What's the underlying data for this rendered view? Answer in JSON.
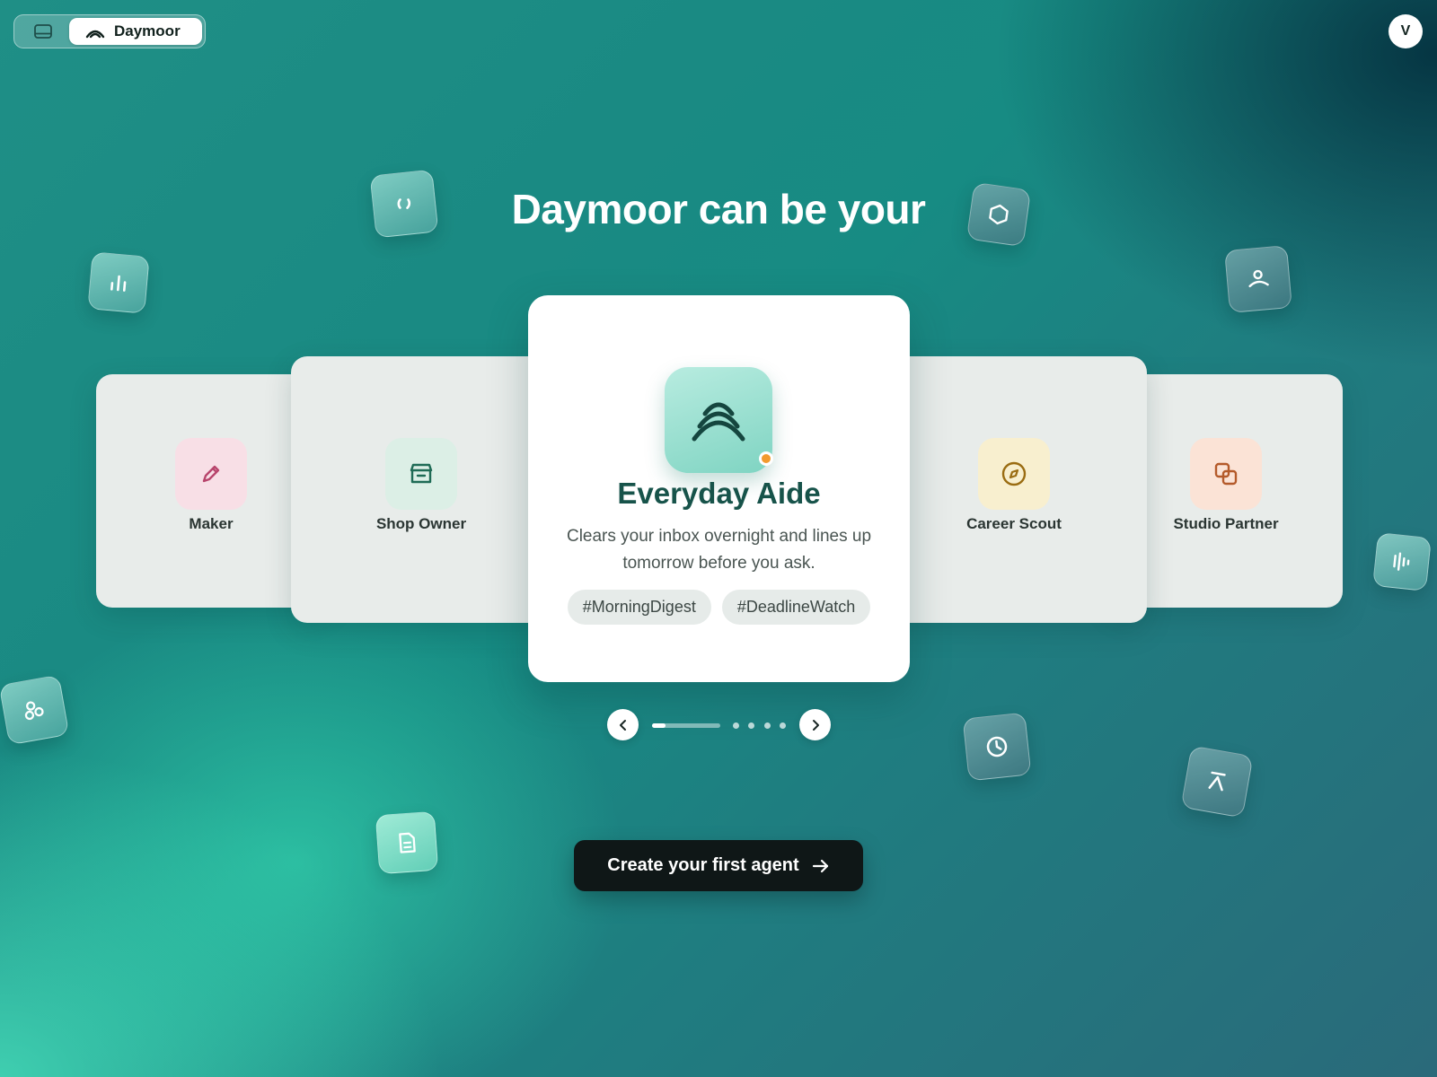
{
  "topbar": {
    "layout_icon": "panel-layout-icon",
    "brand_icon": "daymoor-logo-icon",
    "brand_name": "Daymoor",
    "avatar_initial": "V"
  },
  "headline": "Daymoor can be your",
  "carousel": {
    "cards": [
      {
        "label": "Maker",
        "icon": "pencil-icon",
        "icon_bg": "#f8dfe6",
        "icon_color": "#b8456c"
      },
      {
        "label": "Shop Owner",
        "icon": "storefront-icon",
        "icon_bg": "#dcefe6",
        "icon_color": "#1e6b55"
      },
      {
        "label": "Career Scout",
        "icon": "compass-icon",
        "icon_bg": "#f8efcf",
        "icon_color": "#9a6c12"
      },
      {
        "label": "Studio Partner",
        "icon": "overlap-squares-icon",
        "icon_bg": "#fbe3d6",
        "icon_color": "#b45a2a"
      }
    ],
    "featured": {
      "title": "Everyday Aide",
      "description": "Clears your inbox overnight and lines up tomorrow before you ask.",
      "tags": [
        "#MorningDigest",
        "#DeadlineWatch"
      ],
      "icon": "daymoor-waves-icon",
      "status_color": "#f29a2e"
    },
    "pager": {
      "current": 1,
      "total": 5,
      "progress": 0.2
    }
  },
  "cta": {
    "label": "Create your first agent",
    "icon": "arrow-right-icon"
  },
  "colors": {
    "accent": "#17534a",
    "cta_bg": "#0f1717",
    "background_teal": "#1a8a83"
  }
}
